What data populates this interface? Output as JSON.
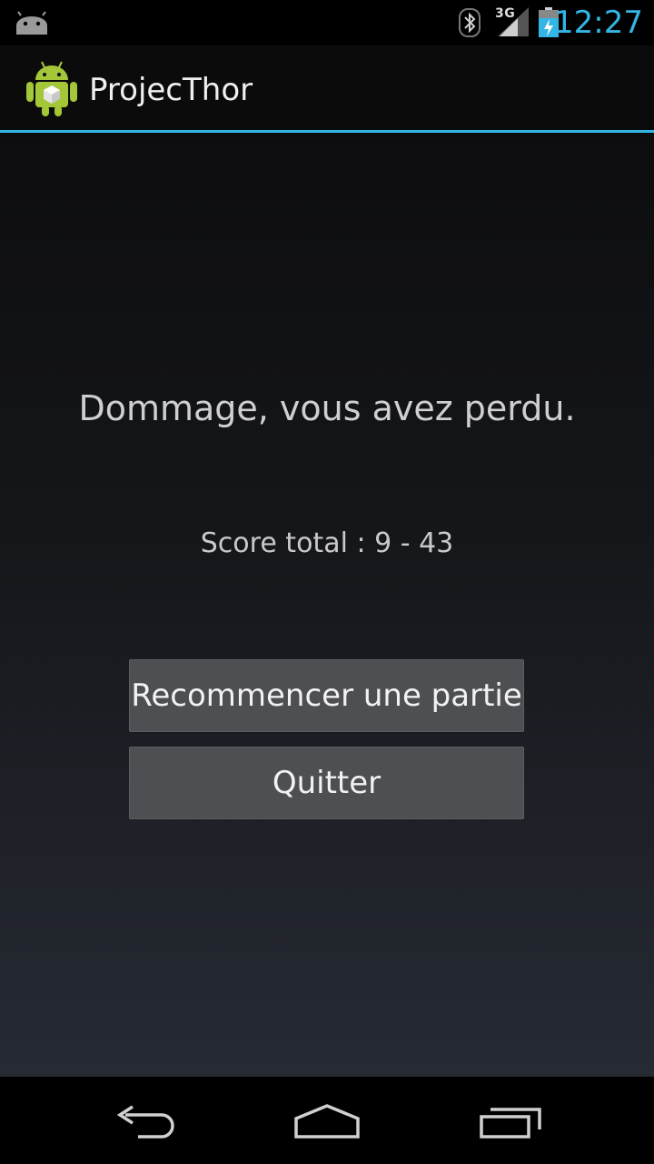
{
  "status_bar": {
    "left_icon": "android-notification-icon",
    "bluetooth_icon": "bluetooth-icon",
    "network_label": "3G",
    "signal_icon": "signal-strength-icon",
    "battery_icon": "battery-charging-icon",
    "clock": "12:27",
    "accent_color": "#33b5e5"
  },
  "action_bar": {
    "app_icon": "android-app-icon",
    "title": "ProjecThor"
  },
  "main": {
    "message": "Dommage, vous avez perdu.",
    "score": "Score total : 9 - 43",
    "restart_label": "Recommencer une partie",
    "quit_label": "Quitter"
  },
  "nav_bar": {
    "back_icon": "back-icon",
    "home_icon": "home-icon",
    "recents_icon": "recent-apps-icon"
  }
}
